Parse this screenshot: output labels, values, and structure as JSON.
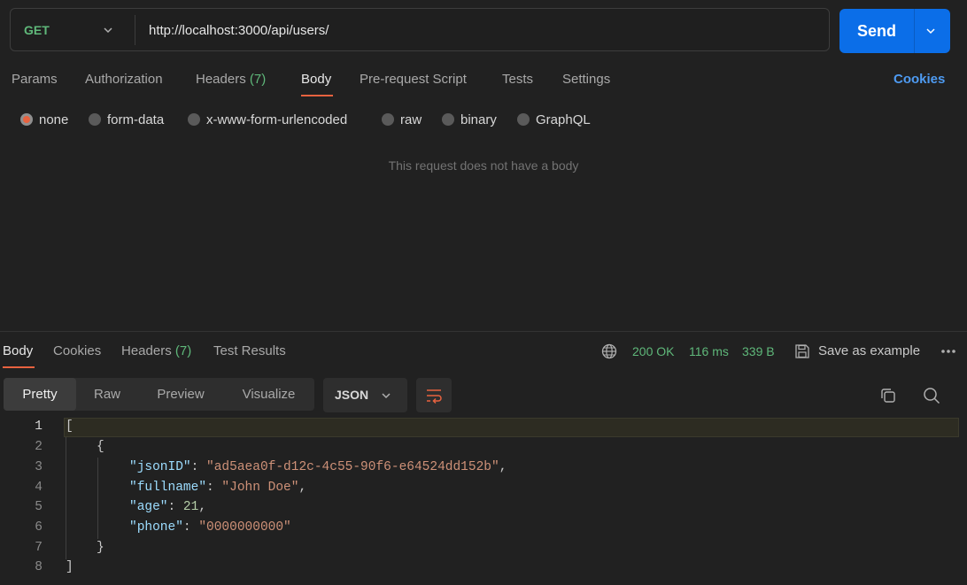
{
  "request": {
    "method": "GET",
    "url": "http://localhost:3000/api/users/",
    "send_label": "Send"
  },
  "request_tabs": [
    {
      "label": "Params"
    },
    {
      "label": "Authorization"
    },
    {
      "label": "Headers",
      "count": "(7)"
    },
    {
      "label": "Body"
    },
    {
      "label": "Pre-request Script"
    },
    {
      "label": "Tests"
    },
    {
      "label": "Settings"
    }
  ],
  "cookies_label": "Cookies",
  "body_types": [
    {
      "label": "none",
      "selected": true
    },
    {
      "label": "form-data"
    },
    {
      "label": "x-www-form-urlencoded"
    },
    {
      "label": "raw"
    },
    {
      "label": "binary"
    },
    {
      "label": "GraphQL"
    }
  ],
  "no_body_message": "This request does not have a body",
  "response_tabs": [
    {
      "label": "Body"
    },
    {
      "label": "Cookies"
    },
    {
      "label": "Headers",
      "count": "(7)"
    },
    {
      "label": "Test Results"
    }
  ],
  "response_status": {
    "status": "200 OK",
    "time": "116 ms",
    "size": "339 B",
    "save_label": "Save as example"
  },
  "view_modes": [
    {
      "label": "Pretty"
    },
    {
      "label": "Raw"
    },
    {
      "label": "Preview"
    },
    {
      "label": "Visualize"
    }
  ],
  "format": "JSON",
  "code": {
    "line_numbers": [
      "1",
      "2",
      "3",
      "4",
      "5",
      "6",
      "7",
      "8"
    ],
    "open_bracket": "[",
    "open_brace": "{",
    "json_id_key": "\"jsonID\"",
    "json_id_value": "\"ad5aea0f-d12c-4c55-90f6-e64524dd152b\"",
    "fullname_key": "\"fullname\"",
    "fullname_value": "\"John Doe\"",
    "age_key": "\"age\"",
    "age_value": "21",
    "phone_key": "\"phone\"",
    "phone_value": "\"0000000000\"",
    "close_brace": "}",
    "close_bracket": "]",
    "colon": ": ",
    "comma": ","
  },
  "colors": {
    "accent": "#e8623f",
    "send": "#0b6ee8",
    "success": "#5fb87a",
    "link": "#4e9bf2"
  }
}
